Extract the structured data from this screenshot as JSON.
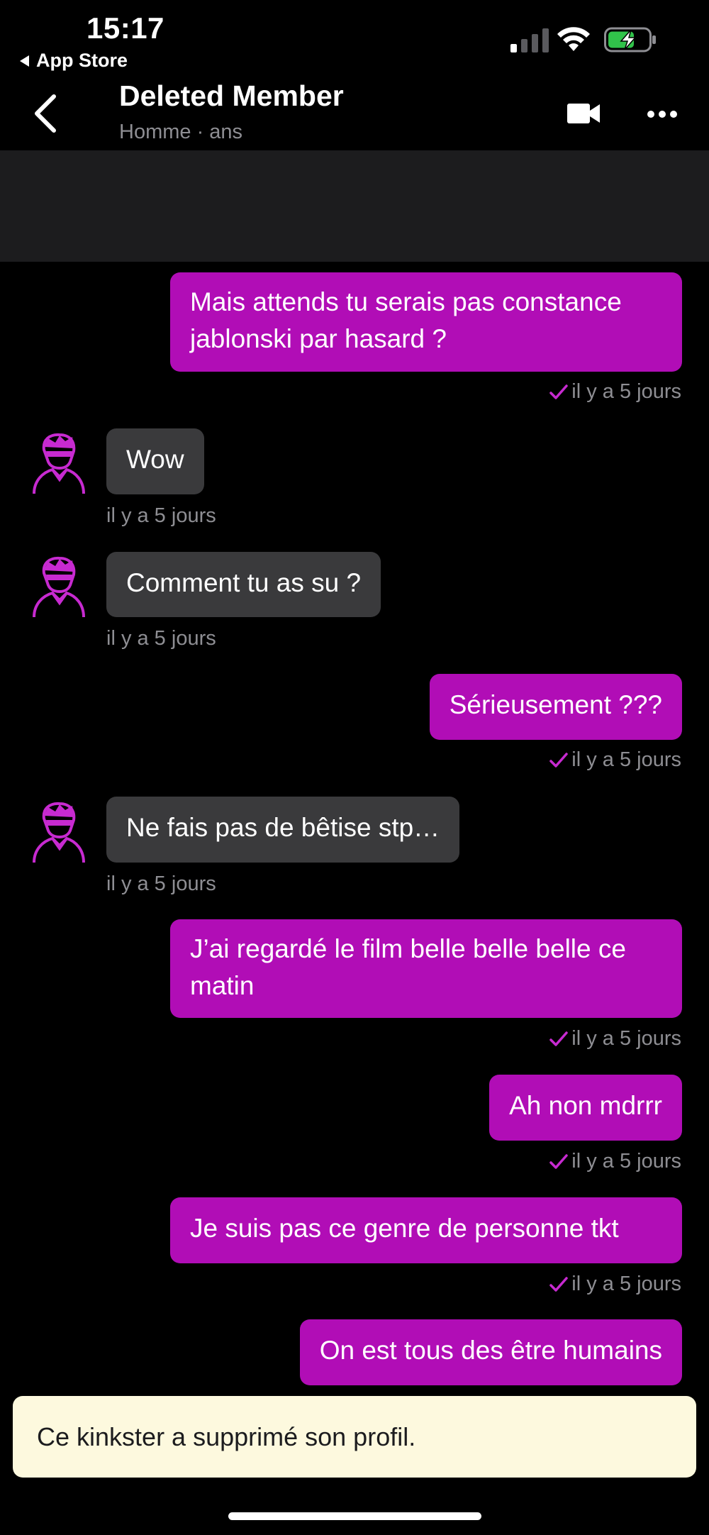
{
  "status_bar": {
    "time": "15:17",
    "back_app": "App Store",
    "battery_color": "#31c24a"
  },
  "header": {
    "title": "Deleted Member",
    "subtitle": "Homme · ans"
  },
  "accent_color": "#b10db6",
  "messages": [
    {
      "dir": "sent",
      "text_lines": [
        "Mais attends tu serais pas constance",
        "jablonski par hasard ?"
      ],
      "time": "il y a 5 jours"
    },
    {
      "dir": "recv",
      "text": "Wow",
      "time": "il y a 5 jours"
    },
    {
      "dir": "recv",
      "text": "Comment tu as su ?",
      "time": "il y a 5 jours"
    },
    {
      "dir": "sent",
      "text": "Sérieusement ???",
      "time": "il y a 5 jours"
    },
    {
      "dir": "recv",
      "text": "Ne fais pas de bêtise stp…",
      "time": "il y a 5 jours"
    },
    {
      "dir": "sent",
      "text_lines": [
        "J’ai regardé le film belle belle belle ce",
        "matin"
      ],
      "time": "il y a 5 jours"
    },
    {
      "dir": "sent",
      "text": "Ah non mdrrr",
      "time": "il y a 5 jours"
    },
    {
      "dir": "sent",
      "text": "Je suis pas ce genre de personne tkt",
      "time": "il y a 5 jours"
    },
    {
      "dir": "sent",
      "text": "On est tous des être humains"
    }
  ],
  "notice": "Ce kinkster a supprimé son profil."
}
